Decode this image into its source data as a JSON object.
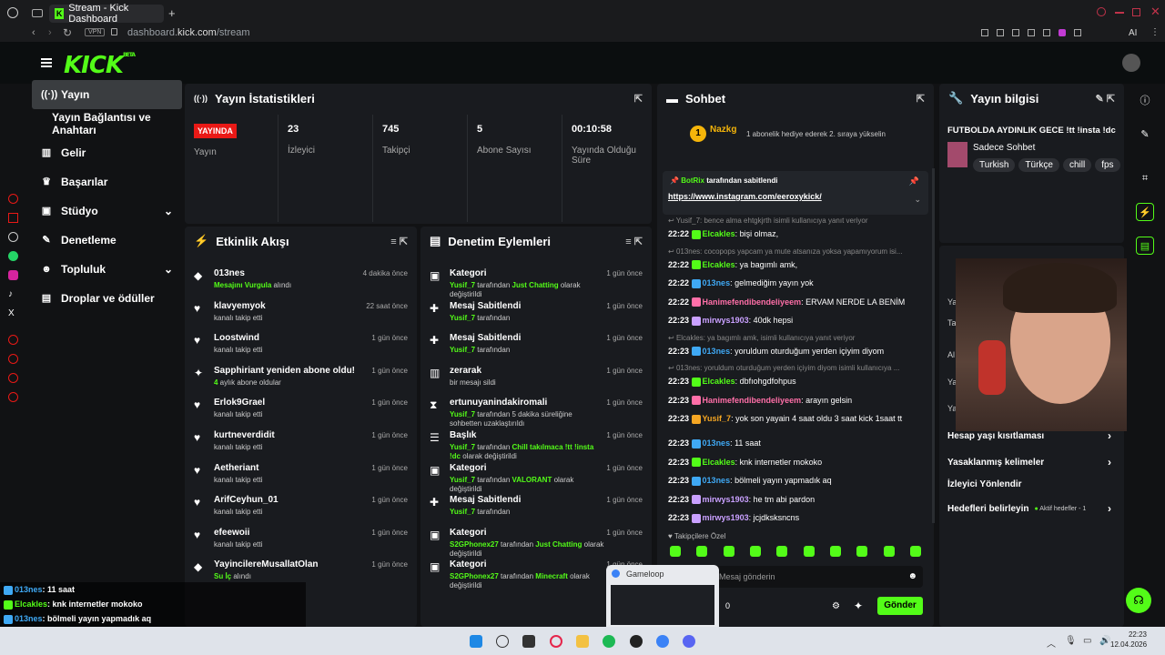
{
  "browser": {
    "tab_title": "Stream - Kick Dashboard",
    "url_domain": "dashboard.",
    "url_bold": "kick.com",
    "url_path": "/stream",
    "vpn": "VPN",
    "ai": "AI"
  },
  "logo": {
    "text": "KICK",
    "beta": "BETA"
  },
  "sidebar": {
    "items": [
      {
        "label": "Yayın",
        "icon": "broadcast-icon"
      },
      {
        "label": "Yayın Bağlantısı ve Anahtarı",
        "icon": ""
      },
      {
        "label": "Gelir",
        "icon": "chart-icon"
      },
      {
        "label": "Başarılar",
        "icon": "trophy-icon"
      },
      {
        "label": "Stüdyo",
        "icon": "studio-icon"
      },
      {
        "label": "Denetleme",
        "icon": "wrench-icon"
      },
      {
        "label": "Topluluk",
        "icon": "community-icon"
      },
      {
        "label": "Droplar ve ödüller",
        "icon": "gift-icon"
      }
    ]
  },
  "stats": {
    "title": "Yayın İstatistikleri",
    "live_badge": "YAYINDA",
    "live_label": "Yayın",
    "cells": [
      {
        "value": "23",
        "label": "İzleyici"
      },
      {
        "value": "745",
        "label": "Takipçi"
      },
      {
        "value": "5",
        "label": "Abone Sayısı"
      },
      {
        "value": "00:10:58",
        "label": "Yayında Olduğu Süre"
      }
    ]
  },
  "activity": {
    "title": "Etkinlik Akışı",
    "items": [
      {
        "name": "013nes",
        "sub_green": "Mesajını Vurgula",
        "sub": " alındı",
        "time": "4 dakika önce",
        "icon": "diamond-icon"
      },
      {
        "name": "klavyemyok",
        "sub": "kanalı takip etti",
        "time": "22 saat önce",
        "icon": "heart-icon"
      },
      {
        "name": "Loostwind",
        "sub": "kanalı takip etti",
        "time": "1 gün önce",
        "icon": "heart-icon"
      },
      {
        "name": "Sapphiriant yeniden abone oldu!",
        "sub_green": "4",
        "sub": " aylık abone oldular",
        "time": "1 gün önce",
        "icon": "sparkle-icon"
      },
      {
        "name": "Erlok9Grael",
        "sub": "kanalı takip etti",
        "time": "1 gün önce",
        "icon": "heart-icon"
      },
      {
        "name": "kurtneverdidit",
        "sub": "kanalı takip etti",
        "time": "1 gün önce",
        "icon": "heart-icon"
      },
      {
        "name": "Aetheriant",
        "sub": "kanalı takip etti",
        "time": "1 gün önce",
        "icon": "heart-icon"
      },
      {
        "name": "ArifCeyhun_01",
        "sub": "kanalı takip etti",
        "time": "1 gün önce",
        "icon": "heart-icon"
      },
      {
        "name": "efeewoii",
        "sub": "kanalı takip etti",
        "time": "1 gün önce",
        "icon": "heart-icon"
      },
      {
        "name": "YayincilereMusallatOlan",
        "sub_green": "Su İç",
        "sub": " alındı",
        "time": "1 gün önce",
        "icon": "diamond-icon"
      }
    ]
  },
  "moderation": {
    "title": "Denetim Eylemleri",
    "items": [
      {
        "name": "Kategori",
        "sub_green": "Yusif_7",
        "sub": " tarafından ",
        "sub_green2": "Just Chatting",
        "sub2": " olarak değiştirildi",
        "time": "1 gün önce",
        "icon": "category-icon"
      },
      {
        "name": "Mesaj Sabitlendi",
        "sub_green": "Yusif_7",
        "sub": " tarafından",
        "time": "1 gün önce",
        "icon": "pin-icon"
      },
      {
        "name": "Mesaj Sabitlendi",
        "sub_green": "Yusif_7",
        "sub": " tarafından",
        "time": "1 gün önce",
        "icon": "pin-icon"
      },
      {
        "name": "zerarak",
        "sub": "bir mesajı sildi",
        "time": "1 gün önce",
        "icon": "trash-icon"
      },
      {
        "name": "ertunuyanindakiromali",
        "sub_green": "Yusif_7",
        "sub": " tarafından 5 dakika süreliğine sohbetten uzaklaştırıldı",
        "time": "1 gün önce",
        "icon": "hourglass-icon"
      },
      {
        "name": "Başlık",
        "sub_green": "Yusif_7",
        "sub": " tarafından ",
        "sub_green2": "Chill takılmaca !tt !insta !dc",
        "sub2": " olarak değiştirildi",
        "time": "1 gün önce",
        "icon": "title-icon"
      },
      {
        "name": "Kategori",
        "sub_green": "Yusif_7",
        "sub": " tarafından ",
        "sub_green2": "VALORANT",
        "sub2": " olarak değiştirildi",
        "time": "1 gün önce",
        "icon": "category-icon"
      },
      {
        "name": "Mesaj Sabitlendi",
        "sub_green": "Yusif_7",
        "sub": " tarafından",
        "time": "1 gün önce",
        "icon": "pin-icon"
      },
      {
        "name": "Kategori",
        "sub_green": "S2GPhonex27",
        "sub": " tarafından ",
        "sub_green2": "Just Chatting",
        "sub2": " olarak değiştirildi",
        "time": "1 gün önce",
        "icon": "category-icon"
      },
      {
        "name": "Kategori",
        "sub_green": "S2GPhonex27",
        "sub": " tarafından ",
        "sub_green2": "Minecraft",
        "sub2": " olarak değiştirildi",
        "time": "1 gün önce",
        "icon": "category-icon"
      }
    ]
  },
  "chat": {
    "title": "Sohbet",
    "top_user": "Nazkg",
    "top_rank": "1",
    "top_text": "1 abonelik hediye ederek 2. sıraya yükselin",
    "pinned_by": "BotRix",
    "pinned_suffix": " tarafından sabitlendi",
    "pinned_link": "https://www.instagram.com/eeroxykick/",
    "lines": [
      {
        "sys": "Yusif_7: bence alma ehtgkjrth isimli kullanıcıya yanıt veriyor"
      },
      {
        "time": "22:22",
        "user": "Elcakles",
        "color": "#53fc18",
        "text": ": bişi olmaz,"
      },
      {
        "sys": "013nes: cocopops yapcam ya mute atsanıza yoksa yapamıyorum isi..."
      },
      {
        "time": "22:22",
        "user": "Elcakles",
        "color": "#53fc18",
        "text": ": ya bagımlı amk,"
      },
      {
        "time": "22:22",
        "user": "013nes",
        "color": "#3fa9f5",
        "text": ": gelmediğim yayın yok"
      },
      {
        "time": "22:22",
        "user": "Hanimefendibendeliyeem",
        "color": "#ff6fa8",
        "text": ": ERVAM NERDE LA BENİM"
      },
      {
        "time": "22:23",
        "user": "mirwys1903",
        "color": "#c9a0ff",
        "text": ": 40dk hepsi"
      },
      {
        "sys": "Elcakles: ya bagımlı amk, isimli kullanıcıya yanıt veriyor"
      },
      {
        "time": "22:23",
        "user": "013nes",
        "color": "#3fa9f5",
        "text": ": yoruldum oturduğum yerden içiyim diyom"
      },
      {
        "sys": "013nes: yoruldum oturduğum yerden içiyim diyom isimli kullanıcıya ..."
      },
      {
        "time": "22:23",
        "user": "Elcakles",
        "color": "#53fc18",
        "text": ": dbfıohgdfohpus"
      },
      {
        "time": "22:23",
        "user": "Hanimefendibendeliyeem",
        "color": "#ff6fa8",
        "text": ": arayın gelsin"
      },
      {
        "time": "22:23",
        "user": "Yusif_7",
        "color": "#f5a623",
        "text": ": yok son yayain 4 saat oldu 3 saat kick 1saat tt"
      },
      {
        "time": "22:23",
        "user": "013nes",
        "color": "#3fa9f5",
        "text": ": 11 saat"
      },
      {
        "time": "22:23",
        "user": "Elcakles",
        "color": "#53fc18",
        "text": ": knk internetler mokoko"
      },
      {
        "time": "22:23",
        "user": "013nes",
        "color": "#3fa9f5",
        "text": ": bölmeli yayın yapmadık aq"
      },
      {
        "time": "22:23",
        "user": "mirwys1903",
        "color": "#c9a0ff",
        "text": ": he tm abi pardon"
      },
      {
        "time": "22:23",
        "user": "mirwys1903",
        "color": "#c9a0ff",
        "text": ": jcjdksksncns"
      }
    ],
    "followers_label": "Takipçilere Özel",
    "input_placeholder": "Mesaj gönderin",
    "counter": "0",
    "send": "Gönder"
  },
  "info": {
    "title": "Yayın bilgisi",
    "stream_title": "FUTBOLDA AYDINLIK GECE !tt !insta !dc",
    "category": "Sadece Sohbet",
    "tags": [
      "Turkish",
      "Türkçe",
      "chill",
      "fps"
    ],
    "rows": [
      {
        "label": "Hesap yaşı kısıtlaması"
      },
      {
        "label": "Yasaklanmış kelimeler"
      },
      {
        "label": "İzleyici Yönlendir"
      },
      {
        "label": "Hedefleri belirleyin",
        "extra": "Aktif hedefler - 1"
      }
    ]
  },
  "popup": {
    "title": "Gameloop"
  },
  "overlay": {
    "lines": [
      {
        "user": "013nes",
        "color": "#3fa9f5",
        "text": ": 11 saat"
      },
      {
        "user": "Elcakles",
        "color": "#53fc18",
        "text": ": knk internetler mokoko"
      },
      {
        "user": "013nes",
        "color": "#3fa9f5",
        "text": ": bölmeli yayın yapmadık aq"
      },
      {
        "user": "mirwys1903",
        "color": "#c9a0ff",
        "text": ": he tm abi pardon"
      },
      {
        "user": "mirwys1903",
        "color": "#c9a0ff",
        "text": ": jcjdksksncns"
      }
    ]
  },
  "taskbar": {
    "time": "22:23",
    "date": "12.04.2026"
  },
  "colors": {
    "accent": "#53fc18",
    "live": "#e91916",
    "panel": "#191b1f"
  }
}
